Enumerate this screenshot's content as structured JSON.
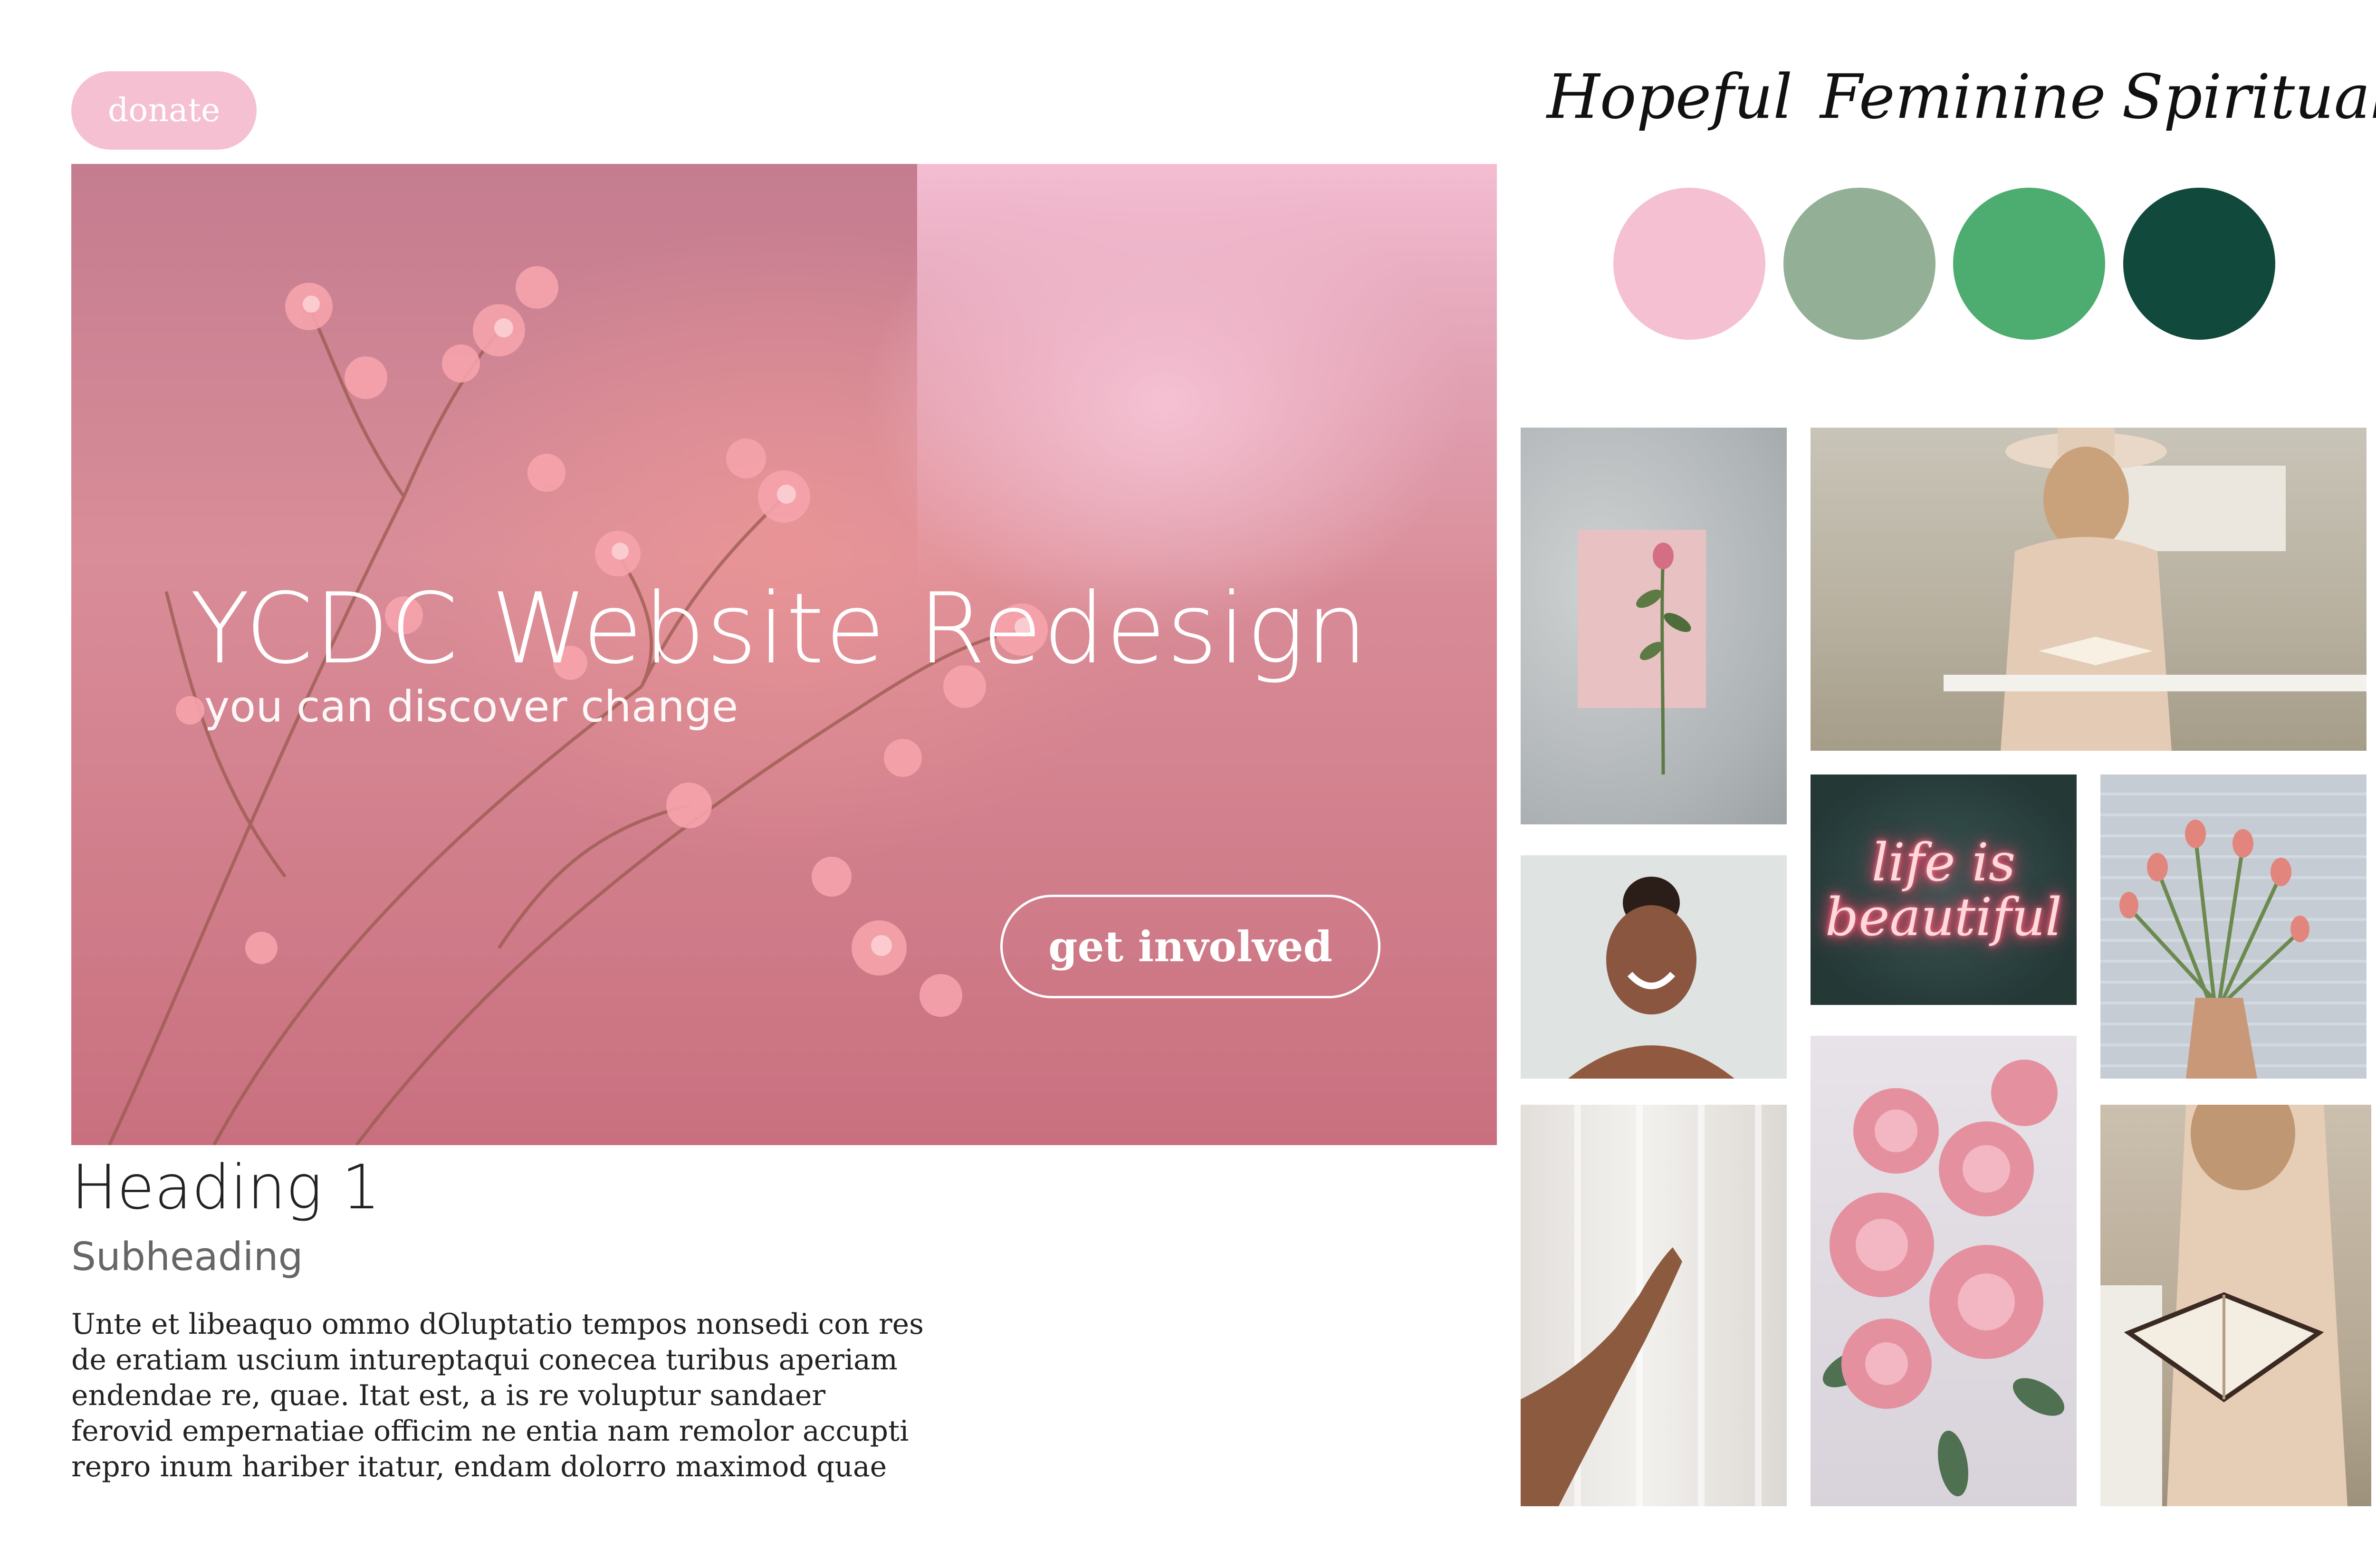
{
  "header": {
    "donate_label": "donate"
  },
  "hero": {
    "title": "YCDC Website Redesign",
    "subtitle": "you can discover change",
    "cta_label": "get involved"
  },
  "content": {
    "heading": "Heading 1",
    "subheading": "Subheading",
    "body_lines": [
      "Unte et libeaquo ommo dOluptatio tempos nonsedi con res",
      "de eratiam uscium intureptaqui conecea turibus aperiam",
      "endendae re, quae. Itat est, a is re voluptur sandaer",
      "ferovid empernatiae officim ne entia nam remolor accupti",
      "repro inum hariber itatur, endam dolorro maximod quae"
    ]
  },
  "keywords": [
    "Hopeful",
    "Feminine",
    "Spiritual"
  ],
  "palette": [
    "#f5c0d2",
    "#93b096",
    "#4dac70",
    "#11493c"
  ],
  "photos": {
    "neon_sign_text": [
      "life is",
      "beautiful"
    ]
  }
}
